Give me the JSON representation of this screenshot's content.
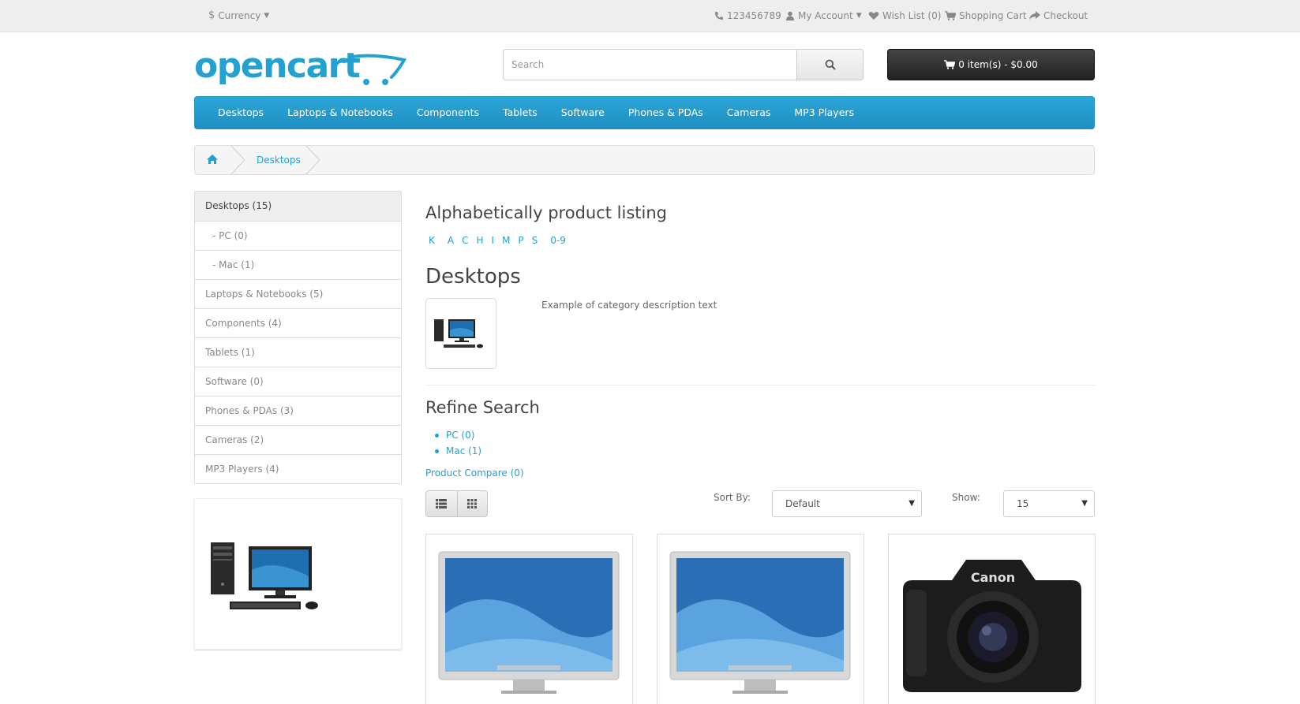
{
  "topbar": {
    "currency_label": "Currency",
    "phone": "123456789",
    "my_account": "My Account",
    "wish_list": "Wish List (0)",
    "shopping_cart": "Shopping Cart",
    "checkout": "Checkout"
  },
  "header": {
    "logo_text": "opencart",
    "search_placeholder": "Search",
    "cart_label": "0 item(s) - $0.00"
  },
  "menu": {
    "items": [
      "Desktops",
      "Laptops & Notebooks",
      "Components",
      "Tablets",
      "Software",
      "Phones & PDAs",
      "Cameras",
      "MP3 Players"
    ]
  },
  "breadcrumb": {
    "current": "Desktops"
  },
  "sidebar": {
    "categories": [
      "Desktops (15)",
      "- PC (0)",
      "- Mac (1)",
      "Laptops & Notebooks (5)",
      "Components (4)",
      "Tablets (1)",
      "Software (0)",
      "Phones & PDAs (3)",
      "Cameras (2)",
      "MP3 Players (4)"
    ]
  },
  "content": {
    "alpha_title": "Alphabetically product listing",
    "alpha_letters": [
      "K",
      "A",
      "C",
      "H",
      "I",
      "M",
      "P",
      "S",
      "0-9"
    ],
    "category_title": "Desktops",
    "category_description": "Example of category description text",
    "refine_title": "Refine Search",
    "refine_items": [
      "PC (0)",
      "Mac (1)"
    ],
    "product_compare": "Product Compare (0)",
    "sort_label": "Sort By:",
    "sort_value": "Default",
    "show_label": "Show:",
    "show_value": "15"
  },
  "products": [
    {
      "image": "apple-cinema-display"
    },
    {
      "image": "apple-cinema-display"
    },
    {
      "image": "canon-eos-5d",
      "brand_text": "Canon"
    }
  ],
  "colors": {
    "accent": "#23a1d1",
    "menu_bg": "#229ac8",
    "cart_bg": "#333333",
    "topbar_bg": "#eeeeee"
  }
}
